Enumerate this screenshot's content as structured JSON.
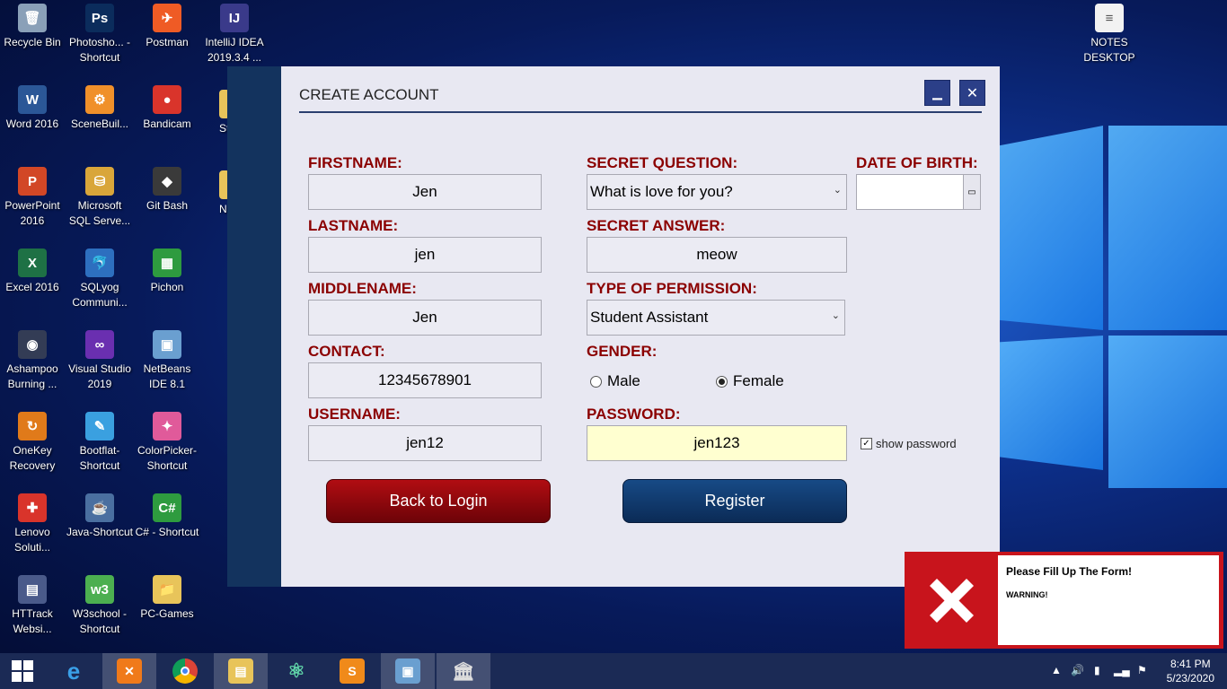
{
  "desktop": {
    "icons": [
      {
        "label": "Recycle Bin",
        "icon": "recycle-bin-icon",
        "color": "#8aa0b8",
        "glyph": "🗑"
      },
      {
        "label": "Photosho... - Shortcut",
        "icon": "photoshop-icon",
        "color": "#0b2c5c",
        "glyph": "Ps"
      },
      {
        "label": "Postman",
        "icon": "postman-icon",
        "color": "#ef5b25",
        "glyph": "✈"
      },
      {
        "label": "IntelliJ IDEA 2019.3.4 ...",
        "icon": "intellij-icon",
        "color": "#3a3a8a",
        "glyph": "IJ"
      },
      {
        "label": "Word 2016",
        "icon": "word-icon",
        "color": "#2b5797",
        "glyph": "W"
      },
      {
        "label": "SceneBuil...",
        "icon": "scenebuilder-icon",
        "color": "#f0902a",
        "glyph": "⚙"
      },
      {
        "label": "Bandicam",
        "icon": "bandicam-icon",
        "color": "#d9342b",
        "glyph": "●"
      },
      {
        "label": "PowerPoint 2016",
        "icon": "powerpoint-icon",
        "color": "#d24726",
        "glyph": "P"
      },
      {
        "label": "Microsoft SQL Serve...",
        "icon": "sql-server-icon",
        "color": "#d9a63a",
        "glyph": "⛁"
      },
      {
        "label": "Git Bash",
        "icon": "git-bash-icon",
        "color": "#3a3a3a",
        "glyph": "◆"
      },
      {
        "label": "Excel 2016",
        "icon": "excel-icon",
        "color": "#1e7145",
        "glyph": "X"
      },
      {
        "label": "SQLyog Communi...",
        "icon": "sqlyog-icon",
        "color": "#2d6fbf",
        "glyph": "🐬"
      },
      {
        "label": "Pichon",
        "icon": "pichon-icon",
        "color": "#2e9b3f",
        "glyph": "▦"
      },
      {
        "label": "Ashampoo Burning ...",
        "icon": "ashampoo-icon",
        "color": "#333c55",
        "glyph": "◉"
      },
      {
        "label": "Visual Studio 2019",
        "icon": "visual-studio-icon",
        "color": "#6a2fb0",
        "glyph": "∞"
      },
      {
        "label": "NetBeans IDE 8.1",
        "icon": "netbeans-icon",
        "color": "#6a9fd0",
        "glyph": "▣"
      },
      {
        "label": "OneKey Recovery",
        "icon": "onekey-icon",
        "color": "#e07a1a",
        "glyph": "↻"
      },
      {
        "label": "Bootflat-Shortcut",
        "icon": "bootflat-icon",
        "color": "#3aa0e0",
        "glyph": "✎"
      },
      {
        "label": "ColorPicker-Shortcut",
        "icon": "colorpicker-icon",
        "color": "#e05a9a",
        "glyph": "✦"
      },
      {
        "label": "Lenovo Soluti...",
        "icon": "lenovo-icon",
        "color": "#d9342b",
        "glyph": "✚"
      },
      {
        "label": "Java-Shortcut",
        "icon": "java-icon",
        "color": "#4a6fa0",
        "glyph": "☕"
      },
      {
        "label": "C# - Shortcut",
        "icon": "csharp-icon",
        "color": "#2e9b3f",
        "glyph": "C#"
      },
      {
        "label": "HTTrack Websi...",
        "icon": "httrack-icon",
        "color": "#4a5a8a",
        "glyph": "▤"
      },
      {
        "label": "W3school - Shortcut",
        "icon": "w3school-icon",
        "color": "#4caf50",
        "glyph": "w3"
      },
      {
        "label": "PC-Games",
        "icon": "folder-icon",
        "color": "#e8c45a",
        "glyph": "📁"
      },
      {
        "label": "NOTES DESKTOP",
        "icon": "notes-icon",
        "color": "#f2f2f2",
        "glyph": "≡"
      }
    ],
    "partial_labels": [
      "St",
      "N"
    ]
  },
  "window": {
    "title": "CREATE ACCOUNT",
    "minimize_glyph": "▁",
    "close_glyph": "✕",
    "labels": {
      "firstname": "FIRSTNAME:",
      "lastname": "LASTNAME:",
      "middlename": "MIDDLENAME:",
      "contact": "CONTACT:",
      "username": "USERNAME:",
      "secret_question": "SECRET QUESTION:",
      "secret_answer": "SECRET ANSWER:",
      "permission": "TYPE OF PERMISSION:",
      "gender": "GENDER:",
      "password": "PASSWORD:",
      "dob": "DATE OF BIRTH:"
    },
    "values": {
      "firstname": "Jen",
      "lastname": "jen",
      "middlename": "Jen",
      "contact": "12345678901",
      "username": "jen12",
      "secret_question": "What is love for you?",
      "secret_answer": "meow",
      "permission": "Student Assistant",
      "password": "jen123",
      "dob": ""
    },
    "gender": {
      "male": "Male",
      "female": "Female",
      "selected": "Female"
    },
    "show_password_label": "show password",
    "show_password_checked": true,
    "buttons": {
      "back": "Back to Login",
      "register": "Register"
    },
    "colors": {
      "label": "#8b0000",
      "sidebar": "#13335e",
      "back_button": "#8b0a10",
      "register_button": "#0f3a6e"
    }
  },
  "notification": {
    "message": "Please Fill Up The Form!",
    "warning": "WARNING!",
    "color": "#c8141c"
  },
  "taskbar": {
    "time": "8:41 PM",
    "date": "5/23/2020",
    "apps": [
      "start-icon",
      "internet-explorer-icon",
      "xampp-icon",
      "chrome-icon",
      "file-explorer-icon",
      "atom-icon",
      "sublime-icon",
      "virtualbox-icon",
      "bank-app-icon"
    ]
  }
}
